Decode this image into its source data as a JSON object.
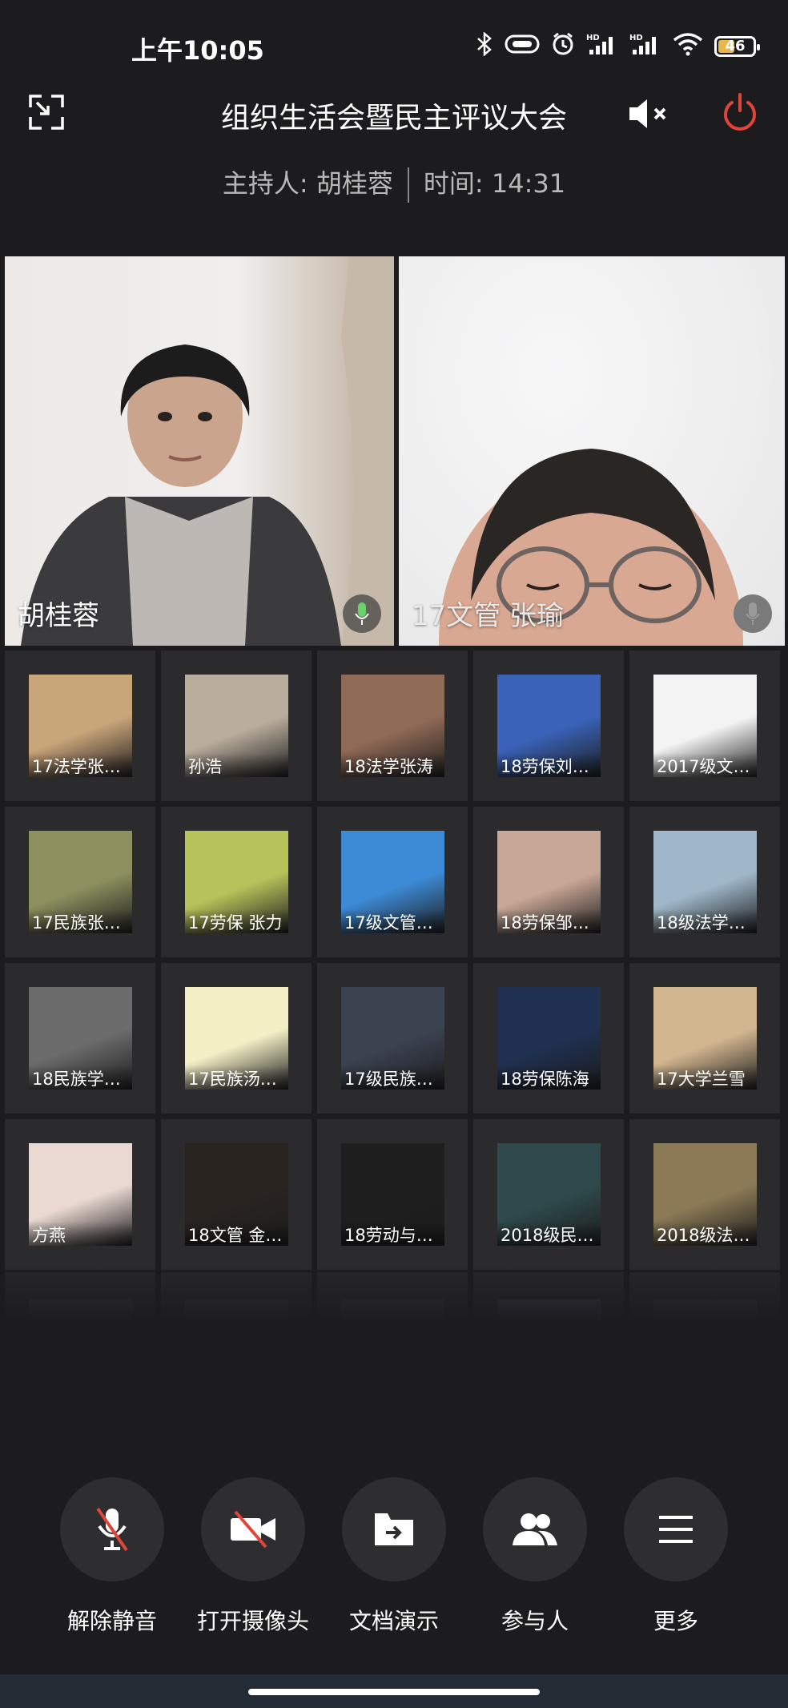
{
  "status_bar": {
    "time": "上午10:05",
    "battery": "46",
    "battery_level": 0.46,
    "icons": [
      "bluetooth-icon",
      "vibrate-icon",
      "alarm-icon",
      "signal-hd-1-icon",
      "signal-hd-2-icon",
      "wifi-icon",
      "battery-icon"
    ]
  },
  "header": {
    "title": "组织生活会暨民主评议大会",
    "host_label": "主持人: 胡桂蓉",
    "time_label": "时间: 14:31"
  },
  "main_videos": [
    {
      "name": "胡桂蓉",
      "mic": "active"
    },
    {
      "name": "17文管 张瑜",
      "mic": "muted"
    }
  ],
  "participants": [
    {
      "label": "17法学张…",
      "color": "#c9a57a"
    },
    {
      "label": "孙浩",
      "color": "#b9ad9c"
    },
    {
      "label": "18法学张涛",
      "color": "#8f6a56"
    },
    {
      "label": "18劳保刘…",
      "color": "#3a62b8"
    },
    {
      "label": "2017级文…",
      "color": "#f3f3f3"
    },
    {
      "label": "17民族张…",
      "color": "#8d8f5e"
    },
    {
      "label": "17劳保 张力",
      "color": "#b8c25a"
    },
    {
      "label": "17级文管…",
      "color": "#3d8ad6"
    },
    {
      "label": "18劳保邹…",
      "color": "#c9a796"
    },
    {
      "label": "18级法学…",
      "color": "#9fb7c8"
    },
    {
      "label": "18民族学…",
      "color": "#6c6c6c"
    },
    {
      "label": "17民族汤…",
      "color": "#f4efc5"
    },
    {
      "label": "17级民族…",
      "color": "#3b4250"
    },
    {
      "label": "18劳保陈海",
      "color": "#1f3050"
    },
    {
      "label": "17大学兰雪",
      "color": "#d2b68f"
    },
    {
      "label": "方燕",
      "color": "#e9d9d2"
    },
    {
      "label": "18文管 金…",
      "color": "#2a2420"
    },
    {
      "label": "18劳动与…",
      "color": "#1e1e1e"
    },
    {
      "label": "2018级民…",
      "color": "#2f4a4c"
    },
    {
      "label": "2018级法…",
      "color": "#8b7a55"
    }
  ],
  "toolbar": {
    "unmute": "解除静音",
    "camera": "打开摄像头",
    "docs": "文档演示",
    "members": "参与人",
    "more": "更多"
  },
  "colors": {
    "background": "#1c1c1e",
    "tile": "#2b2b2d",
    "power": "#e0453a",
    "muted_slash": "#e0453a"
  }
}
